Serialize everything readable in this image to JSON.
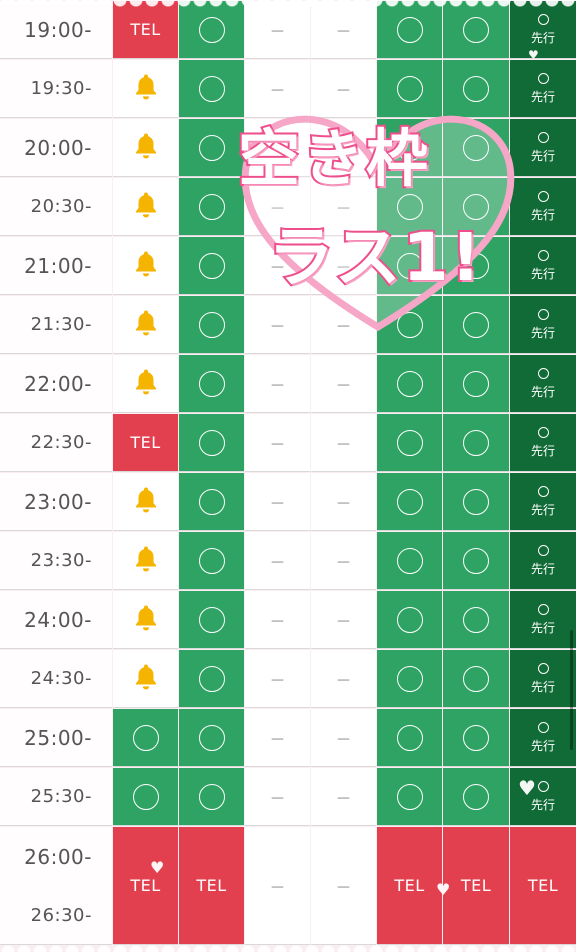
{
  "labels": {
    "tel": "TEL",
    "sensen": "先行",
    "dash": "－"
  },
  "times": [
    "19:00-",
    "19:30-",
    "20:00-",
    "20:30-",
    "21:00-",
    "21:30-",
    "22:00-",
    "22:30-",
    "23:00-",
    "23:30-",
    "24:00-",
    "24:30-",
    "25:00-",
    "25:30-",
    "26:00-",
    "26:30-"
  ],
  "banner": {
    "line1": "空き枠",
    "line2": "ラス1!"
  },
  "rows": [
    [
      "tel",
      "circle",
      "dash",
      "dash",
      "circle",
      "circle",
      "sensen"
    ],
    [
      "bell",
      "circle",
      "dash",
      "dash",
      "circle",
      "circle",
      "sensen"
    ],
    [
      "bell",
      "circle",
      "dash",
      "dash",
      "circle",
      "circle",
      "sensen"
    ],
    [
      "bell",
      "circle",
      "dash",
      "dash",
      "circle",
      "circle",
      "sensen"
    ],
    [
      "bell",
      "circle",
      "dash",
      "dash",
      "circle",
      "circle",
      "sensen"
    ],
    [
      "bell",
      "circle",
      "dash",
      "dash",
      "circle",
      "circle",
      "sensen"
    ],
    [
      "bell",
      "circle",
      "dash",
      "dash",
      "circle",
      "circle",
      "sensen"
    ],
    [
      "tel",
      "circle",
      "dash",
      "dash",
      "circle",
      "circle",
      "sensen"
    ],
    [
      "bell",
      "circle",
      "dash",
      "dash",
      "circle",
      "circle",
      "sensen"
    ],
    [
      "bell",
      "circle",
      "dash",
      "dash",
      "circle",
      "circle",
      "sensen"
    ],
    [
      "bell",
      "circle",
      "dash",
      "dash",
      "circle",
      "circle",
      "sensen"
    ],
    [
      "bell",
      "circle",
      "dash",
      "dash",
      "circle",
      "circle",
      "sensen"
    ],
    [
      "circle",
      "circle",
      "dash",
      "dash",
      "circle",
      "circle",
      "sensen"
    ],
    [
      "circle",
      "circle",
      "dash",
      "dash",
      "circle",
      "circle",
      "sensen"
    ]
  ],
  "last_block": [
    "tel",
    "tel",
    "dash",
    "dash",
    "tel",
    "tel",
    "tel"
  ],
  "colors": {
    "green": "#2ea364",
    "dark_green": "#106b36",
    "tel_red": "#e2404f",
    "bell": "#f5b400",
    "pink": "#ee4f8c"
  },
  "icons": {
    "bell": "bell-icon",
    "circle": "available-circle-icon",
    "heart": "heart-icon"
  }
}
